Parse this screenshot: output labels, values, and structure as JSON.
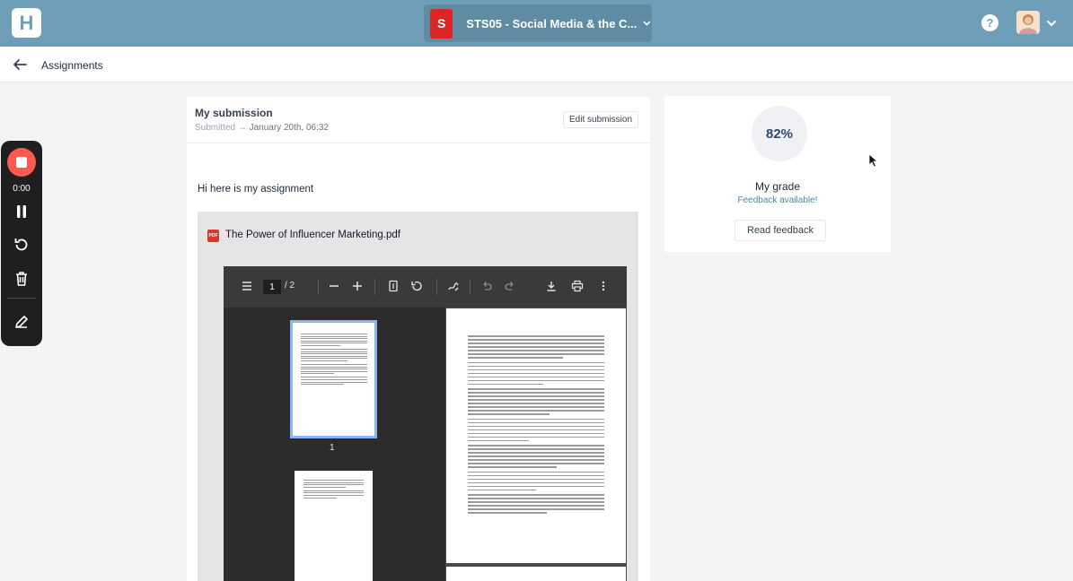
{
  "topbar": {
    "logo_letter": "H",
    "course": {
      "badge": "S",
      "title": "STS05 - Social Media & the C..."
    },
    "help_label": "?"
  },
  "subheader": {
    "breadcrumb": "Assignments"
  },
  "submission": {
    "title": "My submission",
    "status": "Submitted",
    "date": "January 20th, 06:32",
    "edit_label": "Edit submission",
    "text": "Hi here is my assignment",
    "file": {
      "icon_label": "PDF",
      "name": "The Power of Influencer Marketing.pdf"
    },
    "viewer": {
      "current_page": "1",
      "total_pages": "/ 2",
      "thumb_label": "1"
    }
  },
  "grade": {
    "value": "82%",
    "label": "My grade",
    "feedback_status": "Feedback available!",
    "read_label": "Read feedback"
  },
  "recorder": {
    "time": "0:00"
  },
  "colors": {
    "topbar": "#6f9fb8",
    "course_badge": "#dc2626",
    "record_button": "#ff5a4f",
    "feedback_link": "#4a8ba3"
  }
}
